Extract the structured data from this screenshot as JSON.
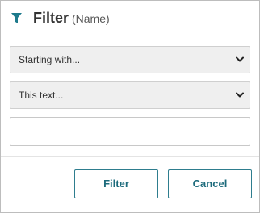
{
  "colors": {
    "accent": "#1d7a8c",
    "button_border": "#2e7d8e",
    "select_bg": "#efefef"
  },
  "header": {
    "icon": "filter-icon",
    "title": "Filter",
    "subtitle": "(Name)"
  },
  "condition_select": {
    "value": "Starting with...",
    "icon": "chevron-down-icon"
  },
  "source_select": {
    "value": "This text...",
    "icon": "chevron-down-icon"
  },
  "text_input": {
    "value": "",
    "placeholder": ""
  },
  "footer": {
    "filter_label": "Filter",
    "cancel_label": "Cancel"
  }
}
